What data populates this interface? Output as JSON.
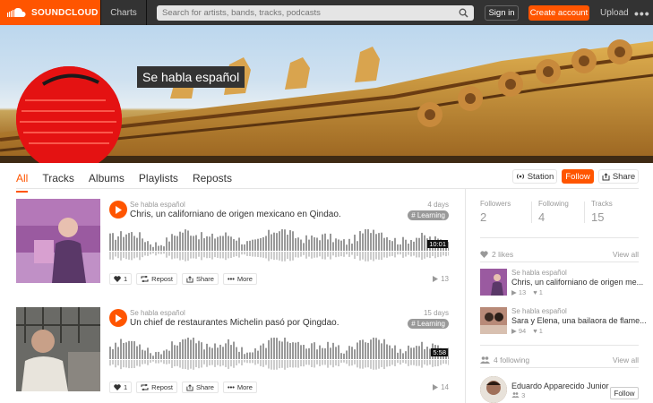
{
  "header": {
    "logo_text": "SOUNDCLOUD",
    "charts_label": "Charts",
    "search_placeholder": "Search for artists, bands, tracks, podcasts",
    "signin_label": "Sign in",
    "create_label": "Create account",
    "upload_label": "Upload",
    "more_label": "•••",
    "accent": "#ff5500"
  },
  "banner": {
    "title": "Se habla español"
  },
  "tabs": [
    {
      "label": "All",
      "active": true
    },
    {
      "label": "Tracks"
    },
    {
      "label": "Albums"
    },
    {
      "label": "Playlists"
    },
    {
      "label": "Reposts"
    }
  ],
  "profile_actions": {
    "station_label": "Station",
    "follow_label": "Follow",
    "share_label": "Share"
  },
  "tracks": [
    {
      "artist": "Se habla español",
      "title": "Chris, un californiano de origen mexicano en Qindao.",
      "date": "4 days",
      "tag": "# Learning",
      "duration": "10:01",
      "likes": "1",
      "repost_label": "Repost",
      "share_label": "Share",
      "more_label": "More",
      "plays": "13"
    },
    {
      "artist": "Se habla español",
      "title": "Un chief de restaurantes Michelin pasó por Qingdao.",
      "date": "15 days",
      "tag": "# Learning",
      "duration": "5:58",
      "likes": "1",
      "repost_label": "Repost",
      "share_label": "Share",
      "more_label": "More",
      "plays": "14"
    }
  ],
  "stats": [
    {
      "label": "Followers",
      "value": "2"
    },
    {
      "label": "Following",
      "value": "4"
    },
    {
      "label": "Tracks",
      "value": "15"
    }
  ],
  "likes_section": {
    "heading": "2 likes",
    "view_all": "View all",
    "items": [
      {
        "artist": "Se habla español",
        "title": "Chris, un californiano de origen me...",
        "plays": "13",
        "likes": "1"
      },
      {
        "artist": "Se habla español",
        "title": "Sara y Elena, una bailaora de flame...",
        "plays": "94",
        "likes": "1"
      }
    ]
  },
  "following_section": {
    "heading": "4 following",
    "view_all": "View all",
    "users": [
      {
        "name": "Eduardo Apparecido Junior",
        "followers": "3",
        "follow_label": "Follow"
      }
    ]
  }
}
